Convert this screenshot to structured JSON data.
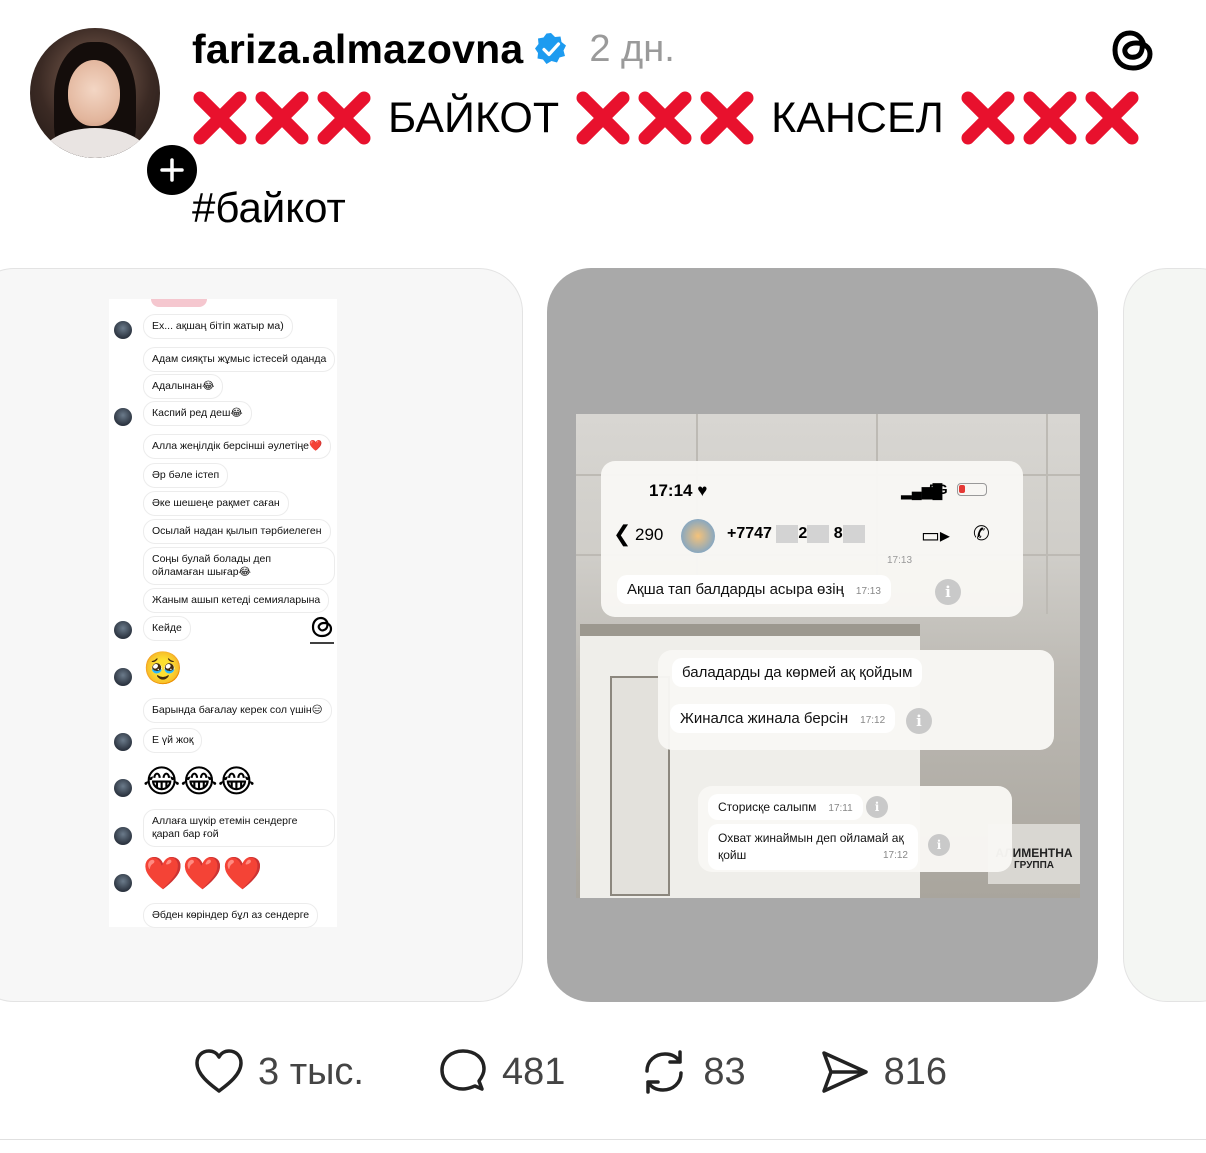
{
  "post": {
    "username": "fariza.almazovna",
    "time": "2 дн.",
    "title": {
      "word1": "БАЙКОТ",
      "word2": "КАНСЕЛ"
    },
    "hashtag": "#байкот"
  },
  "icons": {
    "verified": "verified-badge-icon",
    "threads": "threads-logo-icon",
    "follow": "plus-icon",
    "x_mark": "red-cross-mark-icon",
    "like": "heart-icon",
    "comment": "comment-bubble-icon",
    "repost": "repost-icon",
    "share": "send-icon"
  },
  "colors": {
    "verified": "#1d9bf0",
    "cross": "#e8112d",
    "meta": "#9a9a9a"
  },
  "chat1": {
    "messages": [
      "Ех... ақшаң бітіп жатыр ма)",
      "Адам сияқты жұмыс істесей оданда",
      "Адалынан😂",
      "Каспий ред деш😂",
      "Алла жеңілдік берсінші әулетіңе❤️",
      "Әр бәле істеп",
      "Әке шешеңе рақмет саған",
      "Осылай надан қылып тәрбиелеген",
      "Соңы булай болады деп ойламаған шығар😂",
      "Жаным ашып кетеді семияларына",
      "Кейде",
      "🥹",
      "Барында бағалау керек сол үшін😑",
      "Е үй жоқ",
      "😂😂😂",
      "Аллаға шүкір етемін сендерге қарап бар ғой",
      "❤️❤️❤️",
      "Әбден көріндер бұл аз сендерге"
    ]
  },
  "chat2": {
    "status_time": "17:14",
    "network": "5G",
    "back_count": "290",
    "phone": "+7747",
    "phone_partial": "2",
    "phone_partial2": "8",
    "bubble1": {
      "text": "Ақша тап балдарды асыра өзің",
      "time": "17:13"
    },
    "bubble2": {
      "text": "баладарды да көрмей ақ қойдым",
      "time": ""
    },
    "bubble3": {
      "text": "Жиналса жинала берсін",
      "time": "17:12"
    },
    "bubble4": {
      "text": "Сторисқе салыпм",
      "time": "17:11"
    },
    "bubble5": {
      "text": "Охват жинаймын деп ойламай ақ қойш",
      "time": "17:12"
    },
    "partial_time1": "17:13",
    "sign_text": "АЛИМЕНТНА",
    "sign_sub": "ГРУППА"
  },
  "actions": {
    "likes": "3 тыс.",
    "comments": "481",
    "reposts": "83",
    "shares": "816"
  }
}
